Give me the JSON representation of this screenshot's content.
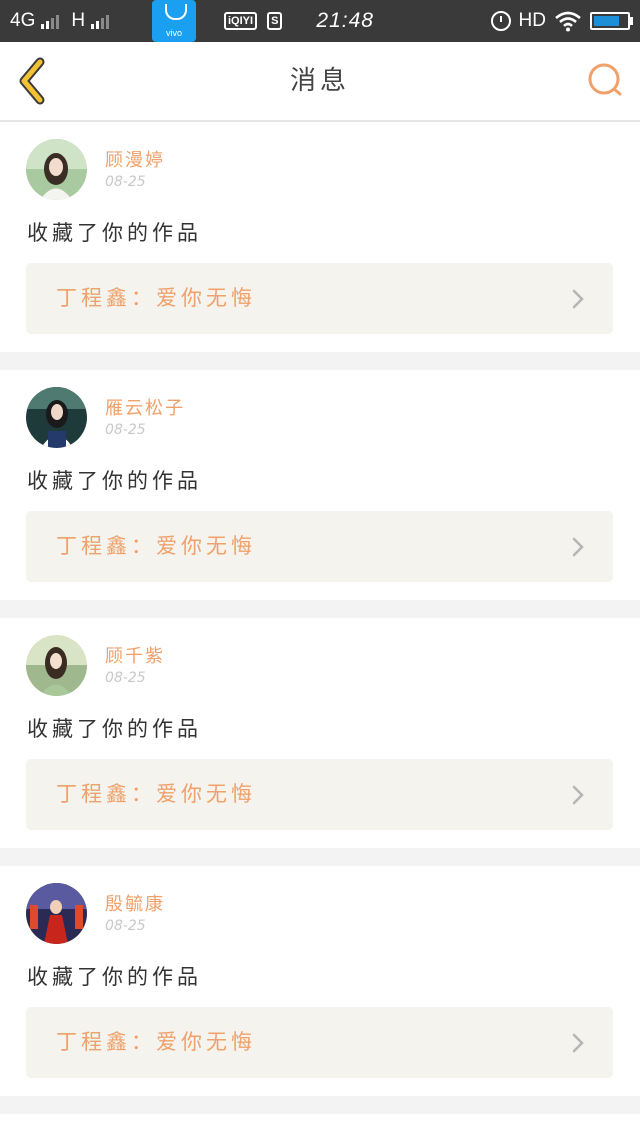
{
  "status_bar": {
    "network1": "4G",
    "network2": "H",
    "app_tile_label": "vivo",
    "icon_iqiyi": "iQIYI",
    "icon_s": "S",
    "time": "21:48",
    "hd": "HD",
    "battery_level": 0.8,
    "icons": [
      "signal-icon",
      "vivo-store-icon",
      "iqiyi-icon",
      "s-icon",
      "alarm-icon",
      "wifi-icon",
      "battery-icon"
    ]
  },
  "nav": {
    "title": "消息",
    "back_icon": "chevron-left-icon",
    "search_icon": "search-icon"
  },
  "colors": {
    "accent": "#f0a16b",
    "back_arrow": "#f2c232",
    "card_bg": "#f4f3ee",
    "separator": "#f3f3f3"
  },
  "messages": [
    {
      "username": "顾漫婷",
      "date": "08-25",
      "action": "收藏了你的作品",
      "work": "丁程鑫：爱你无悔"
    },
    {
      "username": "雁云松子",
      "date": "08-25",
      "action": "收藏了你的作品",
      "work": "丁程鑫：爱你无悔"
    },
    {
      "username": "顾千紫",
      "date": "08-25",
      "action": "收藏了你的作品",
      "work": "丁程鑫：爱你无悔"
    },
    {
      "username": "殷毓康",
      "date": "08-25",
      "action": "收藏了你的作品",
      "work": "丁程鑫：爱你无悔"
    }
  ]
}
